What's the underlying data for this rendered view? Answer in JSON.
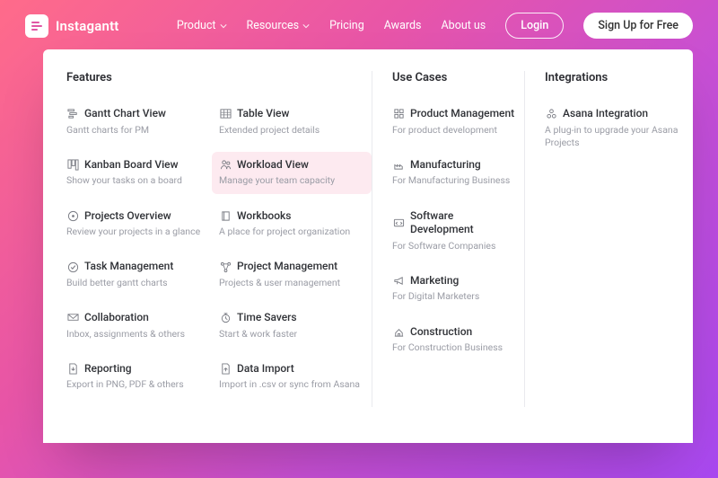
{
  "brand": {
    "name": "Instagantt"
  },
  "nav": {
    "items": [
      {
        "label": "Product",
        "chevron": true
      },
      {
        "label": "Resources",
        "chevron": true
      },
      {
        "label": "Pricing",
        "chevron": false
      },
      {
        "label": "Awards",
        "chevron": false
      },
      {
        "label": "About us",
        "chevron": false
      }
    ],
    "login": "Login",
    "signup": "Sign Up for Free"
  },
  "mega": {
    "features_header": "Features",
    "usecases_header": "Use Cases",
    "integrations_header": "Integrations",
    "features_col1": [
      {
        "title": "Gantt Chart View",
        "desc": "Gantt charts for PM"
      },
      {
        "title": "Kanban Board View",
        "desc": "Show your tasks on a board"
      },
      {
        "title": "Projects Overview",
        "desc": "Review your projects in a glance"
      },
      {
        "title": "Task Management",
        "desc": "Build better gantt charts"
      },
      {
        "title": "Collaboration",
        "desc": "Inbox, assignments & others"
      },
      {
        "title": "Reporting",
        "desc": "Export in PNG, PDF & others"
      }
    ],
    "features_col2": [
      {
        "title": "Table View",
        "desc": "Extended project details"
      },
      {
        "title": "Workload View",
        "desc": "Manage your team capacity",
        "highlight": true
      },
      {
        "title": "Workbooks",
        "desc": "A place for project organization"
      },
      {
        "title": "Project Management",
        "desc": "Projects & user management"
      },
      {
        "title": "Time Savers",
        "desc": "Start & work faster"
      },
      {
        "title": "Data Import",
        "desc": "Import in .csv or sync from Asana"
      }
    ],
    "usecases": [
      {
        "title": "Product Management",
        "desc": "For product development"
      },
      {
        "title": "Manufacturing",
        "desc": "For Manufacturing Business"
      },
      {
        "title": "Software Development",
        "desc": "For Software Companies"
      },
      {
        "title": "Marketing",
        "desc": "For Digital Marketers"
      },
      {
        "title": "Construction",
        "desc": "For Construction Business"
      }
    ],
    "integrations": [
      {
        "title": "Asana Integration",
        "desc": "A plug-in to upgrade your Asana Projects"
      }
    ]
  },
  "colors": {
    "highlight_bg": "#fdeaf0"
  }
}
